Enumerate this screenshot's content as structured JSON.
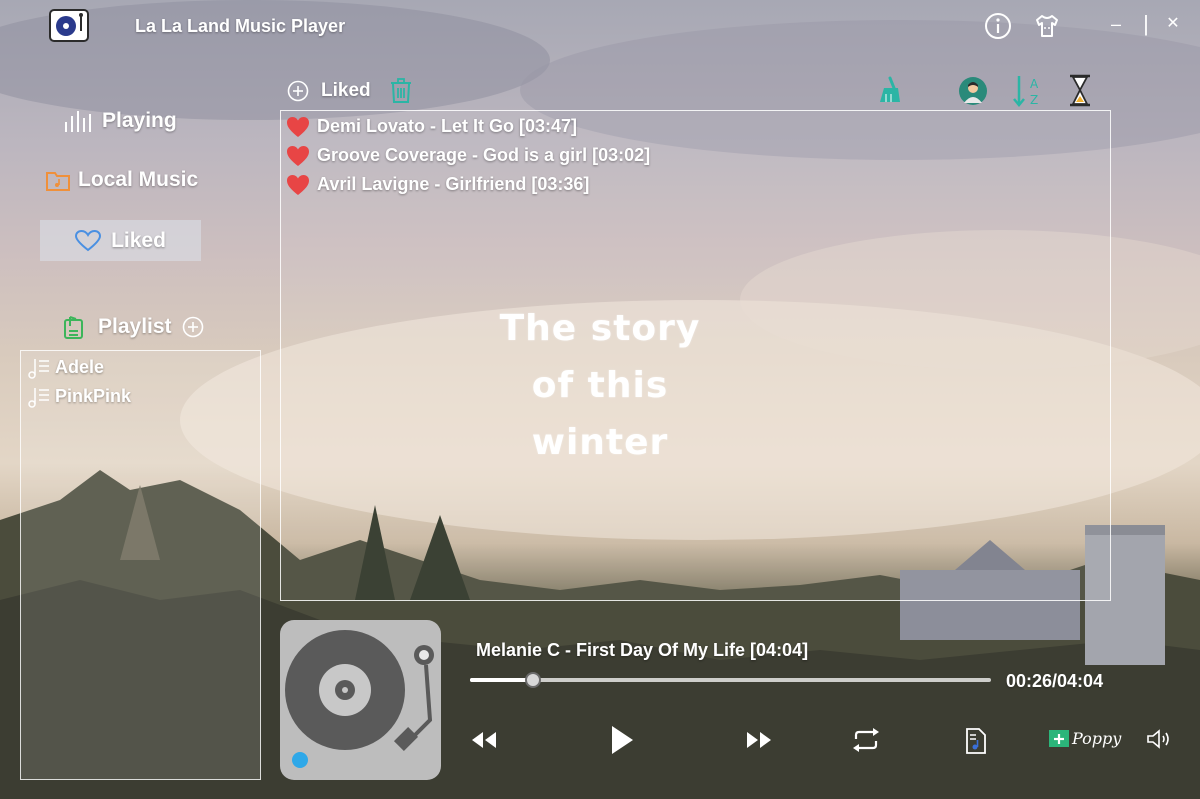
{
  "app": {
    "title": "La La Land Music Player"
  },
  "sidebar": {
    "items": [
      {
        "label": "Playing"
      },
      {
        "label": "Local Music"
      },
      {
        "label": "Liked"
      }
    ],
    "playlist_label": "Playlist",
    "playlists": [
      {
        "label": "Adele"
      },
      {
        "label": "PinkPink"
      }
    ]
  },
  "liked": {
    "header": "Liked",
    "songs": [
      {
        "label": "Demi Lovato - Let It Go [03:47]"
      },
      {
        "label": "Groove Coverage - God is a girl [03:02]"
      },
      {
        "label": "Avril Lavigne - Girlfriend [03:36]"
      }
    ]
  },
  "background_text": [
    "The story",
    "of this",
    "winter"
  ],
  "player": {
    "now_playing": "Melanie C - First Day Of My Life [04:04]",
    "time": "00:26/04:04",
    "progress_fraction": 0.12,
    "mode_label": "Poppy"
  },
  "colors": {
    "heart": "#e84545",
    "accent_teal": "#2bb5a5",
    "liked_blue": "#4a90e2"
  },
  "icons": [
    "info-icon",
    "shirt-icon",
    "minimize-icon",
    "maximize-icon",
    "close-icon",
    "clear-icon",
    "avatar-icon",
    "sort-az-icon",
    "hourglass-icon"
  ]
}
